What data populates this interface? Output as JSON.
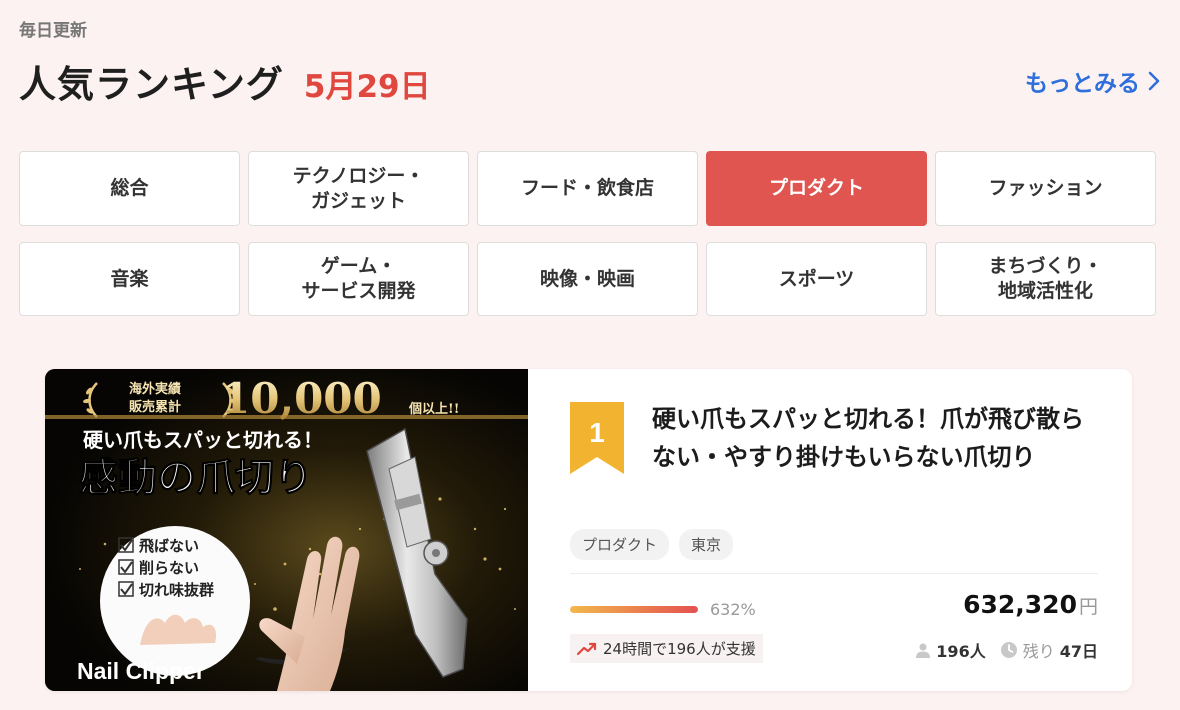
{
  "header": {
    "update_label": "毎日更新",
    "title": "人気ランキング",
    "date": "5月29日",
    "more_label": "もっとみる"
  },
  "categories": [
    {
      "label": "総合",
      "active": false
    },
    {
      "label": "テクノロジー・\nガジェット",
      "active": false
    },
    {
      "label": "フード・飲食店",
      "active": false
    },
    {
      "label": "プロダクト",
      "active": true
    },
    {
      "label": "ファッション",
      "active": false
    },
    {
      "label": "音楽",
      "active": false
    },
    {
      "label": "ゲーム・\nサービス開発",
      "active": false
    },
    {
      "label": "映像・映画",
      "active": false
    },
    {
      "label": "スポーツ",
      "active": false
    },
    {
      "label": "まちづくり・\n地域活性化",
      "active": false
    }
  ],
  "project": {
    "rank": "1",
    "title": "硬い爪もスパッと切れる！爪が飛び散らない・やすり掛けもいらない爪切り",
    "tags": [
      "プロダクト",
      "東京"
    ],
    "progress_percent": 632,
    "progress_label": "632%",
    "amount": "632,320",
    "amount_unit": "円",
    "trend_text": "24時間で196人が支援",
    "supporters": "196人",
    "remaining_label": "残り",
    "remaining_value": "47日",
    "image": {
      "badge_line1": "海外実績",
      "badge_line2": "販売累計",
      "count": "10,000",
      "count_suffix": "個以上!!",
      "catch": "硬い爪もスパッと切れる！",
      "headline": "感動の爪切り",
      "checks": [
        "飛ばない",
        "削らない",
        "切れ味抜群"
      ],
      "product_name": "Nail Clipper"
    }
  },
  "colors": {
    "accent": "#e05550",
    "date": "#e0473f",
    "link": "#2f6fdc",
    "rank_badge": "#f2b430"
  }
}
